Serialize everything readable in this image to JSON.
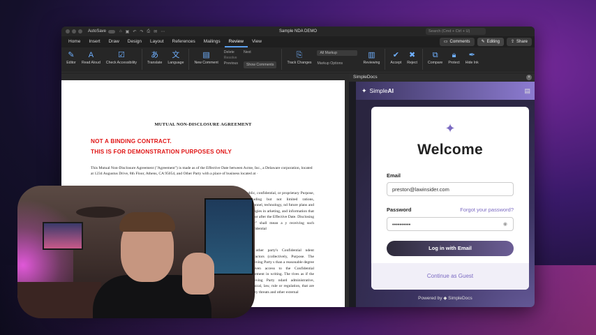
{
  "window": {
    "autosave_label": "AutoSave",
    "doc_title": "Sample NDA DEMO",
    "search_placeholder": "Search (Cmd + Ctrl + U)"
  },
  "tabs": [
    {
      "label": "Home"
    },
    {
      "label": "Insert"
    },
    {
      "label": "Draw"
    },
    {
      "label": "Design"
    },
    {
      "label": "Layout"
    },
    {
      "label": "References"
    },
    {
      "label": "Mailings"
    },
    {
      "label": "Review",
      "active": true
    },
    {
      "label": "View"
    }
  ],
  "header_buttons": {
    "comments": "Comments",
    "editing": "Editing",
    "share": "Share"
  },
  "ribbon": {
    "editor": "Editor",
    "read_aloud": "Read Aloud",
    "check_accessibility": "Check Accessibility",
    "translate": "Translate",
    "language": "Language",
    "new_comment": "New Comment",
    "delete": "Delete",
    "resolve": "Resolve",
    "previous": "Previous",
    "next": "Next",
    "show_comments": "Show Comments",
    "track_changes": "Track Changes",
    "all_markup": "All Markup",
    "markup_options": "Markup Options",
    "reviewing": "Reviewing",
    "accept": "Accept",
    "reject": "Reject",
    "compare": "Compare",
    "protect": "Protect",
    "hide_ink": "Hide Ink"
  },
  "document": {
    "title": "MUTUAL NON-DISCLOSURE AGREEMENT",
    "notice1": "NOT A BINDING CONTRACT.",
    "notice2": "THIS IS FOR DEMONSTRATION PURPOSES ONLY",
    "intro": "This Mutual Non-Disclosure Agreement (\"Agreement\") is made as of the Effective Date between Acme, Inc., a Delaware corporation, located at 1234 Augustus Drive, 8th Floor, Athens, CA 95054, and Other Party with a place of business located at ·",
    "right_col1": "ublic, confidential, or proprietary Purpose, including but not limited rations, personnel, technology, nd future plans and strategies in arketing, and information that a on or after the Effective Date. Disclosing Party\" shall mean a y receiving such Confidential",
    "right_col2": "the other party's Confidential ndent contractors (collectively, Purpose. The Receiving Party s than a reasonable degree of iven access to the Confidential Agreement in writing. The tives as if the Receiving Party ndard administrative, technical, law, rule or regulation, that are ecurity threats and other external"
  },
  "panel": {
    "header": "SimpleDocs",
    "brand_prefix": "Simple",
    "brand_suffix": "AI",
    "welcome": "Welcome",
    "email_label": "Email",
    "email_value": "preston@lawinsider.com",
    "password_label": "Password",
    "forgot": "Forgot your password?",
    "password_value": "••••••••••",
    "login_button": "Log in with Email",
    "guest_link": "Continue as Guest",
    "powered_by": "Powered by",
    "powered_brand": "SimpleDocs"
  }
}
